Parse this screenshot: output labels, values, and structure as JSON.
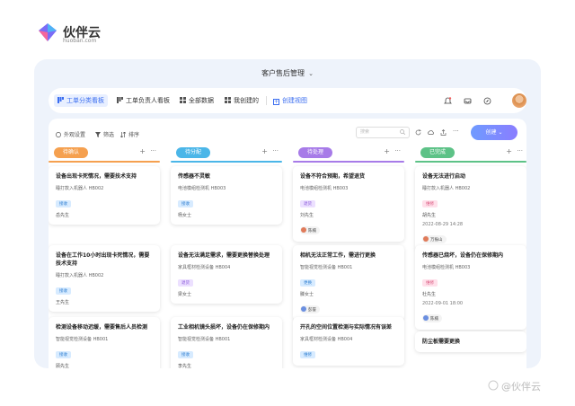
{
  "brand": {
    "name": "伙伴云",
    "domain": "huoban.com"
  },
  "app": {
    "title": "客户售后管理"
  },
  "nav": {
    "tabs": [
      {
        "label": "工单分类看板",
        "icon": "kanban-icon",
        "active": true
      },
      {
        "label": "工单负责人看板",
        "icon": "kanban-icon"
      },
      {
        "label": "全部数据",
        "icon": "grid-icon"
      },
      {
        "label": "我创建的",
        "icon": "grid-icon"
      }
    ],
    "create_view": "创建视图"
  },
  "toolbar": {
    "appearance": "外观设置",
    "filter": "筛选",
    "sort": "排序",
    "search_placeholder": "搜索",
    "create": "创建"
  },
  "columns": [
    {
      "label": "待确认",
      "color": "#f5a04f",
      "cards": [
        {
          "title": "设备出现卡死情况，需要技术支持",
          "sub": "睡打款入机器人 HB002",
          "tag": "接收",
          "tag_color": "blue",
          "person": "岳先生"
        },
        {
          "title": "设备在工作10小时出现卡死情况，需要技术支持",
          "sub": "睡打款入机器人 HB002",
          "tag": "接收",
          "tag_color": "blue",
          "person": "王先生"
        },
        {
          "title": "检测设备移动迟缓，需要售后人员检测",
          "sub": "智能视觉检测设备 HB001",
          "tag": "接收",
          "tag_color": "blue",
          "person": "顾先生"
        }
      ]
    },
    {
      "label": "待分配",
      "color": "#4bb6e8",
      "cards": [
        {
          "title": "传感器不灵敏",
          "sub": "电池模组检测机 HB003",
          "tag": "接收",
          "tag_color": "blue",
          "person": "杨女士"
        },
        {
          "title": "设备无法满足需求，需要更换替换处理",
          "sub": "家具框材检测设备 HB004",
          "tag": "退货",
          "tag_color": "purple",
          "person": "梁女士"
        },
        {
          "title": "工业相机镜头损坏，设备仍在保修期内",
          "sub": "智能视觉检测设备 HB001",
          "tag": "接收",
          "tag_color": "blue",
          "person": "李先生"
        }
      ]
    },
    {
      "label": "待处理",
      "color": "#a77be8",
      "cards": [
        {
          "title": "设备不符合预期，希望退货",
          "sub": "电池模组检测机 HB003",
          "tag": "退货",
          "tag_color": "purple",
          "person": "刘先生",
          "assignee": "陈楠"
        },
        {
          "title": "相机无法正常工作，需进行更换",
          "sub": "智能视觉检测设备 HB001",
          "tag": "更换",
          "tag_color": "blue",
          "person": "滕女士",
          "assignee": "彭誉"
        },
        {
          "title": "开孔的空间位置检测与实际情况有误差",
          "sub": "家具框材检测设备 HB004",
          "tag": "维修",
          "tag_color": "blue",
          "person": ""
        }
      ]
    },
    {
      "label": "已完成",
      "color": "#5dc287",
      "cards": [
        {
          "title": "设备无法进行启动",
          "sub": "睡打款入机器人 HB002",
          "tag": "维修",
          "tag_color": "pink",
          "person": "胡先生",
          "date": "2022-08-29 14:28",
          "assignee": "万振山"
        },
        {
          "title": "传感器已烧坏，设备仍在保修期内",
          "sub": "电池模组检测机 HB003",
          "tag": "维修",
          "tag_color": "pink",
          "person": "杜先生",
          "date": "2022-09-01 18:00",
          "assignee": "陈楠"
        },
        {
          "title": "防尘板需要更换",
          "sub": "",
          "tag": "",
          "tag_color": "",
          "person": ""
        }
      ]
    }
  ],
  "watermark": "@伙伴云"
}
